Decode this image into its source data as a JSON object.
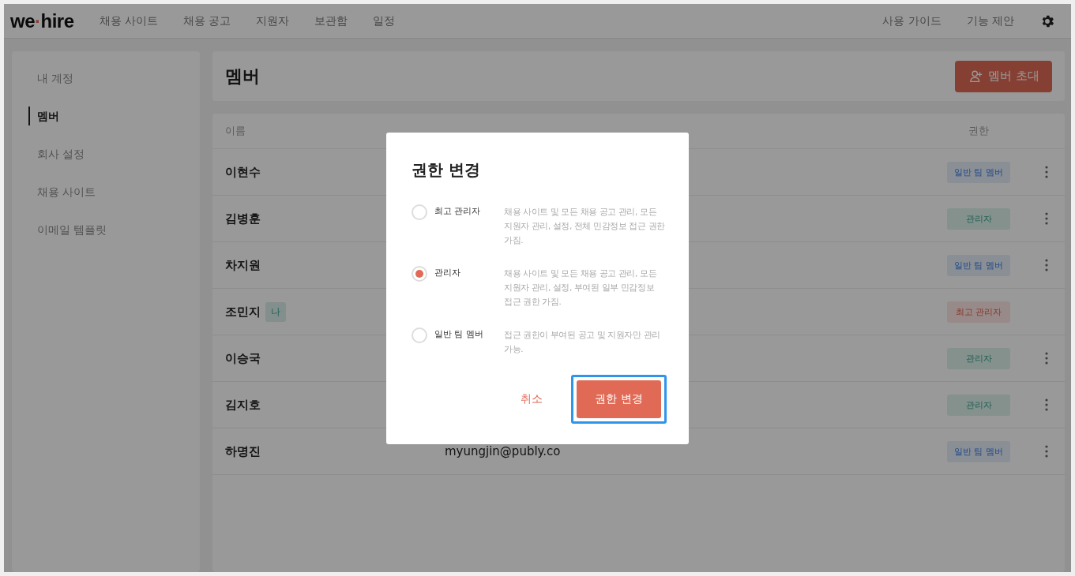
{
  "header": {
    "logo": {
      "left": "we",
      "dot": "·",
      "right": "hire"
    },
    "nav": [
      "채용 사이트",
      "채용 공고",
      "지원자",
      "보관함",
      "일정"
    ],
    "links": [
      "사용 가이드",
      "기능 제안"
    ]
  },
  "sidebar": {
    "items": [
      {
        "label": "내 계정",
        "selected": false
      },
      {
        "label": "멤버",
        "selected": true
      },
      {
        "label": "회사 설정",
        "selected": false
      },
      {
        "label": "채용 사이트",
        "selected": false
      },
      {
        "label": "이메일 템플릿",
        "selected": false
      }
    ]
  },
  "page": {
    "title": "멤버",
    "invite_button": "멤버 초대"
  },
  "table": {
    "columns": [
      "이름",
      "권한"
    ],
    "rows": [
      {
        "name": "이현수",
        "role": "일반 팀 멤버",
        "kind": "member",
        "has_menu": true
      },
      {
        "name": "김병훈",
        "role": "관리자",
        "kind": "admin",
        "has_menu": true
      },
      {
        "name": "차지원",
        "role": "일반 팀 멤버",
        "kind": "member",
        "has_menu": true
      },
      {
        "name": "조민지",
        "me_badge": "나",
        "role": "최고 관리자",
        "kind": "owner",
        "has_menu": false
      },
      {
        "name": "이승국",
        "role": "관리자",
        "kind": "admin",
        "has_menu": true
      },
      {
        "name": "김지호",
        "role": "관리자",
        "kind": "admin",
        "has_menu": true
      },
      {
        "name": "하명진",
        "email": "myungjin@publy.co",
        "role": "일반 팀 멤버",
        "kind": "member",
        "has_menu": true
      }
    ]
  },
  "dialog": {
    "title": "권한 변경",
    "options": [
      {
        "label": "최고 관리자",
        "description": "채용 사이트 및 모든 채용 공고 관리, 모든 지원자 관리, 설정, 전체 민감정보 접근 권한 가짐.",
        "selected": false
      },
      {
        "label": "관리자",
        "description": "채용 사이트 및 모든 채용 공고 관리, 모든 지원자 관리, 설정, 부여된 일부 민감정보 접근 권한 가짐.",
        "selected": true
      },
      {
        "label": "일반 팀 멤버",
        "description": "접근 권한이 부여된 공고 및 지원자만 관리 가능.",
        "selected": false
      }
    ],
    "cancel": "취소",
    "confirm": "권한 변경",
    "confirm_focused": true
  }
}
